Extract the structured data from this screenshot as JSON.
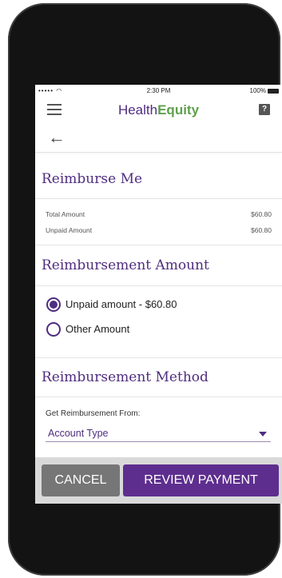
{
  "status_bar": {
    "signal": "•••••",
    "time": "2:30 PM",
    "battery": "100%"
  },
  "app_bar": {
    "logo_part1": "Health",
    "logo_part2": "Equity",
    "help_label": "?"
  },
  "nav": {
    "back": "←"
  },
  "reimburse": {
    "title": "Reimburse Me",
    "rows": [
      {
        "label": "Total Amount",
        "value": "$60.80"
      },
      {
        "label": "Unpaid Amount",
        "value": "$60.80"
      }
    ]
  },
  "amount": {
    "title": "Reimbursement Amount",
    "options": [
      {
        "label": "Unpaid amount - $60.80",
        "selected": true
      },
      {
        "label": "Other Amount",
        "selected": false
      }
    ]
  },
  "method": {
    "title": "Reimbursement Method",
    "field_label": "Get Reimbursement From:",
    "select_value": "Account Type"
  },
  "footer": {
    "cancel_label": "CANCEL",
    "review_label": "REVIEW PAYMENT"
  },
  "colors": {
    "accent": "#4f2d7f",
    "logo_green": "#5fa04e",
    "cancel_bg": "#767676",
    "review_bg": "#5e2e8f"
  }
}
